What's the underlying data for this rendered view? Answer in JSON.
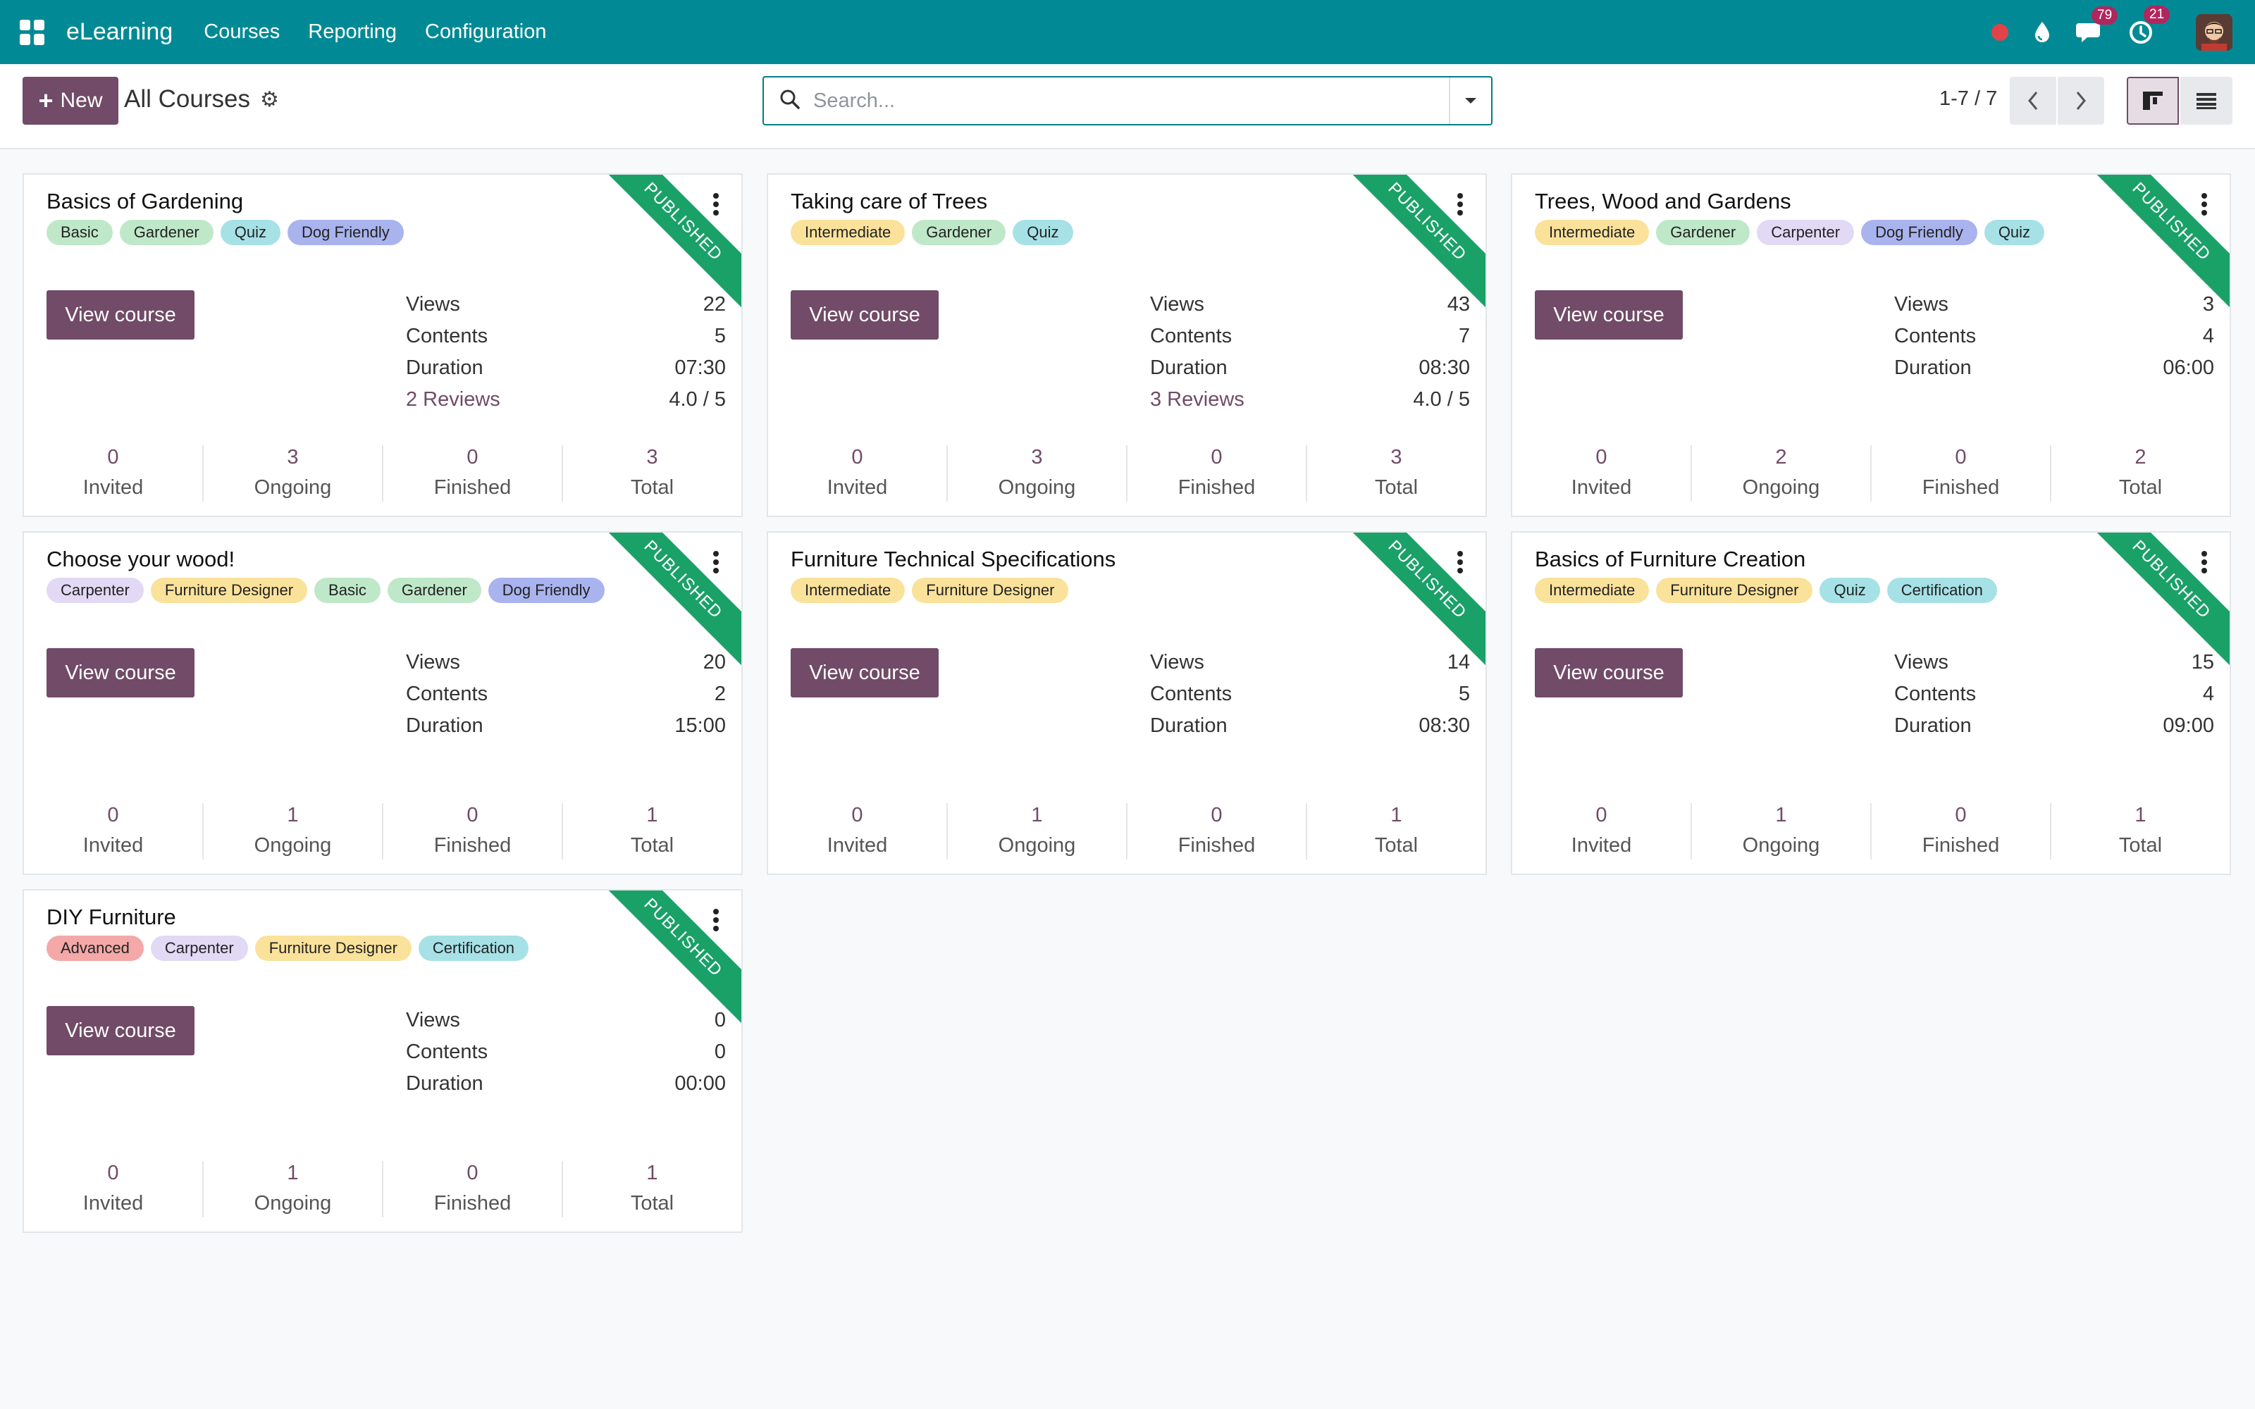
{
  "navbar": {
    "brand": "eLearning",
    "menu": [
      "Courses",
      "Reporting",
      "Configuration"
    ],
    "messages_badge": "79",
    "activities_badge": "21",
    "colors": {
      "bar": "#018a95",
      "badge": "#b0265e"
    }
  },
  "control": {
    "new_label": "New",
    "breadcrumb": "All Courses",
    "search_placeholder": "Search...",
    "pager": "1-7 / 7"
  },
  "courses": [
    {
      "title": "Basics of Gardening",
      "ribbon": "PUBLISHED",
      "tags": [
        {
          "label": "Basic",
          "color": "#bfe8c8"
        },
        {
          "label": "Gardener",
          "color": "#bfe8c8"
        },
        {
          "label": "Quiz",
          "color": "#a6e1e6"
        },
        {
          "label": "Dog Friendly",
          "color": "#a9b3ee"
        }
      ],
      "button": "View course",
      "stats": [
        {
          "label": "Views",
          "value": "22"
        },
        {
          "label": "Contents",
          "value": "5"
        },
        {
          "label": "Duration",
          "value": "07:30"
        },
        {
          "label": "2 Reviews",
          "value": "4.0 / 5",
          "link": true
        }
      ],
      "footer": [
        {
          "num": "0",
          "label": "Invited"
        },
        {
          "num": "3",
          "label": "Ongoing"
        },
        {
          "num": "0",
          "label": "Finished"
        },
        {
          "num": "3",
          "label": "Total"
        }
      ]
    },
    {
      "title": "Taking care of Trees",
      "ribbon": "PUBLISHED",
      "tags": [
        {
          "label": "Intermediate",
          "color": "#fbe29b"
        },
        {
          "label": "Gardener",
          "color": "#bfe8c8"
        },
        {
          "label": "Quiz",
          "color": "#a6e1e6"
        }
      ],
      "button": "View course",
      "stats": [
        {
          "label": "Views",
          "value": "43"
        },
        {
          "label": "Contents",
          "value": "7"
        },
        {
          "label": "Duration",
          "value": "08:30"
        },
        {
          "label": "3 Reviews",
          "value": "4.0 / 5",
          "link": true
        }
      ],
      "footer": [
        {
          "num": "0",
          "label": "Invited"
        },
        {
          "num": "3",
          "label": "Ongoing"
        },
        {
          "num": "0",
          "label": "Finished"
        },
        {
          "num": "3",
          "label": "Total"
        }
      ]
    },
    {
      "title": "Trees, Wood and Gardens",
      "ribbon": "PUBLISHED",
      "tags": [
        {
          "label": "Intermediate",
          "color": "#fbe29b"
        },
        {
          "label": "Gardener",
          "color": "#bfe8c8"
        },
        {
          "label": "Carpenter",
          "color": "#e2d9f5"
        },
        {
          "label": "Dog Friendly",
          "color": "#a9b3ee"
        },
        {
          "label": "Quiz",
          "color": "#a6e1e6"
        }
      ],
      "button": "View course",
      "stats": [
        {
          "label": "Views",
          "value": "3"
        },
        {
          "label": "Contents",
          "value": "4"
        },
        {
          "label": "Duration",
          "value": "06:00"
        }
      ],
      "footer": [
        {
          "num": "0",
          "label": "Invited"
        },
        {
          "num": "2",
          "label": "Ongoing"
        },
        {
          "num": "0",
          "label": "Finished"
        },
        {
          "num": "2",
          "label": "Total"
        }
      ]
    },
    {
      "title": "Choose your wood!",
      "ribbon": "PUBLISHED",
      "tags": [
        {
          "label": "Carpenter",
          "color": "#e2d9f5"
        },
        {
          "label": "Furniture Designer",
          "color": "#fbe29b"
        },
        {
          "label": "Basic",
          "color": "#bfe8c8"
        },
        {
          "label": "Gardener",
          "color": "#bfe8c8"
        },
        {
          "label": "Dog Friendly",
          "color": "#a9b3ee"
        }
      ],
      "button": "View course",
      "stats": [
        {
          "label": "Views",
          "value": "20"
        },
        {
          "label": "Contents",
          "value": "2"
        },
        {
          "label": "Duration",
          "value": "15:00"
        }
      ],
      "footer": [
        {
          "num": "0",
          "label": "Invited"
        },
        {
          "num": "1",
          "label": "Ongoing"
        },
        {
          "num": "0",
          "label": "Finished"
        },
        {
          "num": "1",
          "label": "Total"
        }
      ]
    },
    {
      "title": "Furniture Technical Specifications",
      "ribbon": "PUBLISHED",
      "tags": [
        {
          "label": "Intermediate",
          "color": "#fbe29b"
        },
        {
          "label": "Furniture Designer",
          "color": "#fbe29b"
        }
      ],
      "button": "View course",
      "stats": [
        {
          "label": "Views",
          "value": "14"
        },
        {
          "label": "Contents",
          "value": "5"
        },
        {
          "label": "Duration",
          "value": "08:30"
        }
      ],
      "footer": [
        {
          "num": "0",
          "label": "Invited"
        },
        {
          "num": "1",
          "label": "Ongoing"
        },
        {
          "num": "0",
          "label": "Finished"
        },
        {
          "num": "1",
          "label": "Total"
        }
      ]
    },
    {
      "title": "Basics of Furniture Creation",
      "ribbon": "PUBLISHED",
      "tags": [
        {
          "label": "Intermediate",
          "color": "#fbe29b"
        },
        {
          "label": "Furniture Designer",
          "color": "#fbe29b"
        },
        {
          "label": "Quiz",
          "color": "#a6e1e6"
        },
        {
          "label": "Certification",
          "color": "#a6e1e6"
        }
      ],
      "button": "View course",
      "stats": [
        {
          "label": "Views",
          "value": "15"
        },
        {
          "label": "Contents",
          "value": "4"
        },
        {
          "label": "Duration",
          "value": "09:00"
        }
      ],
      "footer": [
        {
          "num": "0",
          "label": "Invited"
        },
        {
          "num": "1",
          "label": "Ongoing"
        },
        {
          "num": "0",
          "label": "Finished"
        },
        {
          "num": "1",
          "label": "Total"
        }
      ]
    },
    {
      "title": "DIY Furniture",
      "ribbon": "PUBLISHED",
      "tags": [
        {
          "label": "Advanced",
          "color": "#f4a8a8"
        },
        {
          "label": "Carpenter",
          "color": "#e2d9f5"
        },
        {
          "label": "Furniture Designer",
          "color": "#fbe29b"
        },
        {
          "label": "Certification",
          "color": "#a6e1e6"
        }
      ],
      "button": "View course",
      "stats": [
        {
          "label": "Views",
          "value": "0"
        },
        {
          "label": "Contents",
          "value": "0"
        },
        {
          "label": "Duration",
          "value": "00:00"
        }
      ],
      "footer": [
        {
          "num": "0",
          "label": "Invited"
        },
        {
          "num": "1",
          "label": "Ongoing"
        },
        {
          "num": "0",
          "label": "Finished"
        },
        {
          "num": "1",
          "label": "Total"
        }
      ]
    }
  ]
}
